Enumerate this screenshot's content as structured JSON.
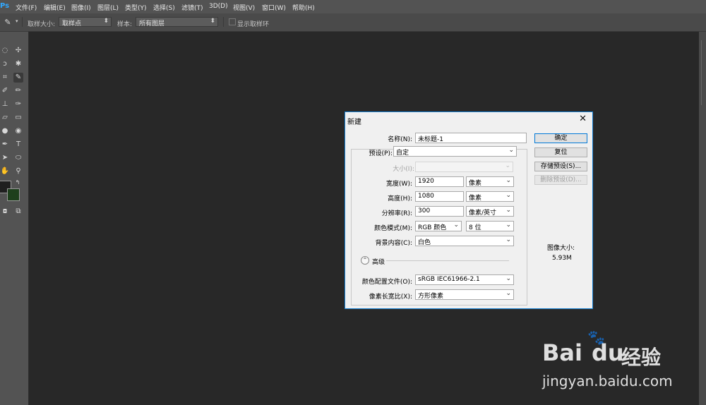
{
  "app": {
    "logo": "Ps"
  },
  "menubar": {
    "items": [
      "文件(F)",
      "编辑(E)",
      "图像(I)",
      "图层(L)",
      "类型(Y)",
      "选择(S)",
      "滤镜(T)",
      "3D(D)",
      "视图(V)",
      "窗口(W)",
      "帮助(H)"
    ]
  },
  "options": {
    "sample_size_label": "取样大小:",
    "sample_size_value": "取样点",
    "sample_label": "样本:",
    "sample_value": "所有图层",
    "show_ring_label": "显示取样环"
  },
  "colors": {
    "foreground": "#1f1f1f",
    "background": "#1e3f1c",
    "accent": "#1883d7"
  },
  "dialog": {
    "title": "新建",
    "name_label": "名称(N):",
    "name_value": "未标题-1",
    "preset_label": "预设(P):",
    "preset_value": "自定",
    "size_label": "大小(I):",
    "size_value": "",
    "width_label": "宽度(W):",
    "width_value": "1920",
    "width_unit": "像素",
    "height_label": "高度(H):",
    "height_value": "1080",
    "height_unit": "像素",
    "resolution_label": "分辨率(R):",
    "resolution_value": "300",
    "resolution_unit": "像素/英寸",
    "color_mode_label": "颜色模式(M):",
    "color_mode_value": "RGB 颜色",
    "bit_depth_value": "8 位",
    "background_label": "背景内容(C):",
    "background_value": "白色",
    "advanced_label": "高级",
    "color_profile_label": "颜色配置文件(O):",
    "color_profile_value": "sRGB IEC61966-2.1",
    "pixel_aspect_label": "像素长宽比(X):",
    "pixel_aspect_value": "方形像素",
    "buttons": {
      "ok": "确定",
      "reset": "复位",
      "save_preset": "存储预设(S)...",
      "delete_preset": "删除预设(D)..."
    },
    "image_size_label": "图像大小:",
    "image_size_value": "5.93M"
  },
  "watermark": {
    "brand": "Bai",
    "brand2": "du",
    "suffix": "经验",
    "url": "jingyan.baidu.com"
  }
}
